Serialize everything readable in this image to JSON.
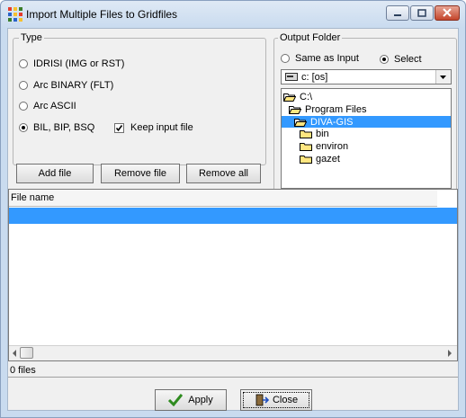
{
  "window": {
    "title": "Import Multiple Files to Gridfiles"
  },
  "type_group": {
    "legend": "Type",
    "options": [
      {
        "label": "IDRISI (IMG or RST)",
        "selected": false
      },
      {
        "label": "Arc BINARY (FLT)",
        "selected": false
      },
      {
        "label": "Arc ASCII",
        "selected": false
      },
      {
        "label": "BIL, BIP, BSQ",
        "selected": true
      }
    ],
    "keep_input": {
      "label": "Keep input file",
      "checked": true
    }
  },
  "file_buttons": {
    "add": "Add file",
    "remove": "Remove file",
    "remove_all": "Remove all"
  },
  "output_folder": {
    "legend": "Output Folder",
    "same_as_input": "Same as Input",
    "select": "Select",
    "selected_option": "Select",
    "drive": "c: [os]",
    "tree": [
      {
        "label": "C:\\",
        "depth": 0,
        "icon": "open-folder-icon",
        "selected": false
      },
      {
        "label": "Program Files",
        "depth": 1,
        "icon": "open-folder-icon",
        "selected": false
      },
      {
        "label": "DIVA-GIS",
        "depth": 2,
        "icon": "open-folder-icon",
        "selected": true
      },
      {
        "label": "bin",
        "depth": 3,
        "icon": "folder-icon",
        "selected": false
      },
      {
        "label": "environ",
        "depth": 3,
        "icon": "folder-icon",
        "selected": false
      },
      {
        "label": "gazet",
        "depth": 3,
        "icon": "folder-icon",
        "selected": false
      }
    ]
  },
  "file_list": {
    "column": "File name"
  },
  "status": {
    "text": "0 files"
  },
  "actions": {
    "apply": "Apply",
    "close": "Close"
  },
  "colors": {
    "selection": "#3399ff",
    "apply_check": "#2e8b1f"
  }
}
